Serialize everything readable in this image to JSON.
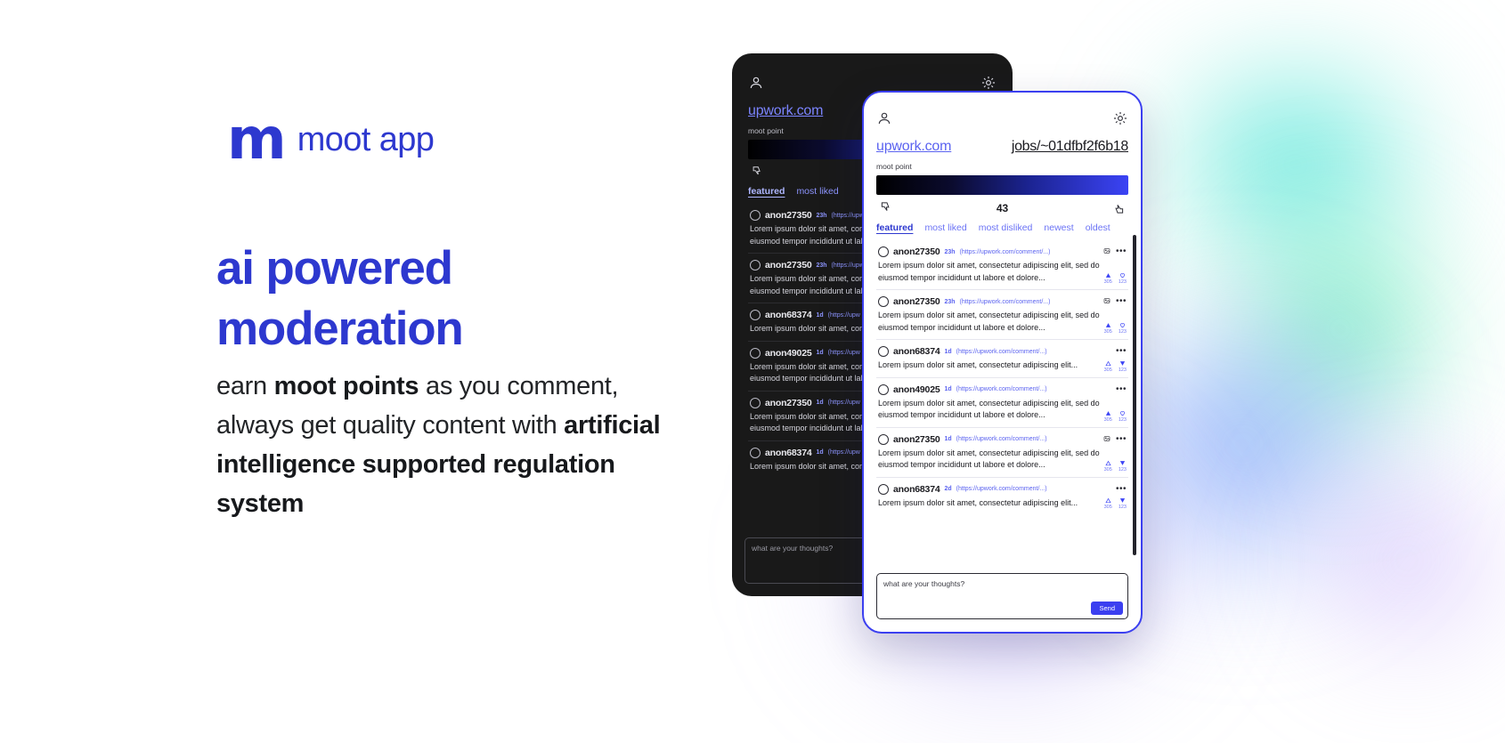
{
  "brand": {
    "mark": "m",
    "name": "moot app",
    "color": "#2d38cf"
  },
  "hero": {
    "headline_line1": "ai powered",
    "headline_line2": "moderation",
    "subcopy_parts": {
      "p1": "earn ",
      "b1": "moot points",
      "p2": " as you comment, always get quality content with ",
      "b2": "artificial intelligence supported regulation system"
    }
  },
  "app": {
    "header": {
      "person_icon": "person-icon",
      "gear_icon": "gear-icon",
      "site": "upwork.com",
      "path": "jobs/~01dfbf2f6b18",
      "moot_point_label": "moot point",
      "score": "43",
      "dislike_icon": "thumbs-down-icon",
      "like_icon": "thumbs-up-icon"
    },
    "tabs": [
      {
        "label": "featured",
        "active": true
      },
      {
        "label": "most liked",
        "active": false
      },
      {
        "label": "most disliked",
        "active": false
      },
      {
        "label": "newest",
        "active": false
      },
      {
        "label": "oldest",
        "active": false
      }
    ],
    "comments": [
      {
        "user": "anon27350",
        "time": "23h",
        "link": "(https://upwork.com/comment/...)",
        "body": "Lorem ipsum dolor sit amet, consectetur adipiscing elit, sed do eiusmod tempor incididunt ut labore et dolore...",
        "up": "305",
        "down": "123",
        "up_state": "up",
        "down_state": "heart"
      },
      {
        "user": "anon27350",
        "time": "23h",
        "link": "(https://upwork.com/comment/...)",
        "body": "Lorem ipsum dolor sit amet, consectetur adipiscing elit, sed do eiusmod tempor incididunt ut labore et dolore...",
        "up": "305",
        "down": "123",
        "up_state": "up",
        "down_state": "heart"
      },
      {
        "user": "anon68374",
        "time": "1d",
        "link": "(https://upwork.com/comment/...)",
        "body": "Lorem ipsum dolor sit amet, consectetur adipiscing elit...",
        "up": "305",
        "down": "123",
        "up_state": "outline",
        "down_state": "down"
      },
      {
        "user": "anon49025",
        "time": "1d",
        "link": "(https://upwork.com/comment/...)",
        "body": "Lorem ipsum dolor sit amet, consectetur adipiscing elit, sed do eiusmod tempor incididunt ut labore et dolore...",
        "up": "305",
        "down": "123",
        "up_state": "up",
        "down_state": "heart"
      },
      {
        "user": "anon27350",
        "time": "1d",
        "link": "(https://upwork.com/comment/...)",
        "body": "Lorem ipsum dolor sit amet, consectetur adipiscing elit, sed do eiusmod tempor incididunt ut labore et dolore...",
        "up": "305",
        "down": "123",
        "up_state": "outline",
        "down_state": "down"
      },
      {
        "user": "anon68374",
        "time": "2d",
        "link": "(https://upwork.com/comment/...)",
        "body": "Lorem ipsum dolor sit amet, consectetur adipiscing elit...",
        "up": "305",
        "down": "123",
        "up_state": "outline",
        "down_state": "down"
      }
    ],
    "composer": {
      "placeholder": "what are your thoughts?",
      "send_label": "Send"
    }
  },
  "app_back": {
    "header": {
      "site": "upwork.com",
      "moot_point_label": "moot point"
    },
    "tabs": [
      {
        "label": "featured",
        "active": true
      },
      {
        "label": "most liked",
        "active": false
      }
    ],
    "comments": [
      {
        "user": "anon27350",
        "time": "23h",
        "link": "(https://upw",
        "body": "Lorem ipsum dolor sit amet, consectetur adipiscing elit, sed do eiusmod tempor incididunt ut labore"
      },
      {
        "user": "anon27350",
        "time": "23h",
        "link": "(https://upw",
        "body": "Lorem ipsum dolor sit amet, consectetur adipiscing elit, sed do eiusmod tempor incididunt ut labore"
      },
      {
        "user": "anon68374",
        "time": "1d",
        "link": "(https://upw",
        "body": "Lorem ipsum dolor sit amet, consectetur adipiscing elit"
      },
      {
        "user": "anon49025",
        "time": "1d",
        "link": "(https://upw",
        "body": "Lorem ipsum dolor sit amet, consectetur adipiscing elit, sed do eiusmod tempor incididunt ut labore"
      },
      {
        "user": "anon27350",
        "time": "1d",
        "link": "(https://upw",
        "body": "Lorem ipsum dolor sit amet, consectetur adipiscing elit, sed do eiusmod tempor incididunt ut labore"
      },
      {
        "user": "anon68374",
        "time": "1d",
        "link": "(https://upw",
        "body": "Lorem ipsum dolor sit amet, consectetur adipiscing elit"
      }
    ],
    "composer": {
      "placeholder": "what are your thoughts?"
    }
  }
}
